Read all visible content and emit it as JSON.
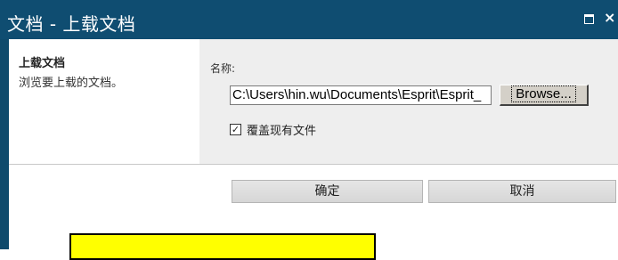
{
  "window": {
    "title": "文档 - 上载文档",
    "maximize_glyph": "□",
    "close_glyph": "×"
  },
  "upload_section": {
    "title": "上载文档",
    "description": "浏览要上载的文档。"
  },
  "file_field": {
    "label": "名称:",
    "value": "C:\\Users\\hin.wu\\Documents\\Esprit\\Esprit_",
    "browse_label": "Browse..."
  },
  "overwrite_option": {
    "label": "覆盖现有文件",
    "checked": true,
    "check_mark": "✓"
  },
  "actions": {
    "ok_label": "确定",
    "cancel_label": "取消"
  },
  "colors": {
    "title_bar": "#0f4d71",
    "highlight": "#ffff00"
  }
}
